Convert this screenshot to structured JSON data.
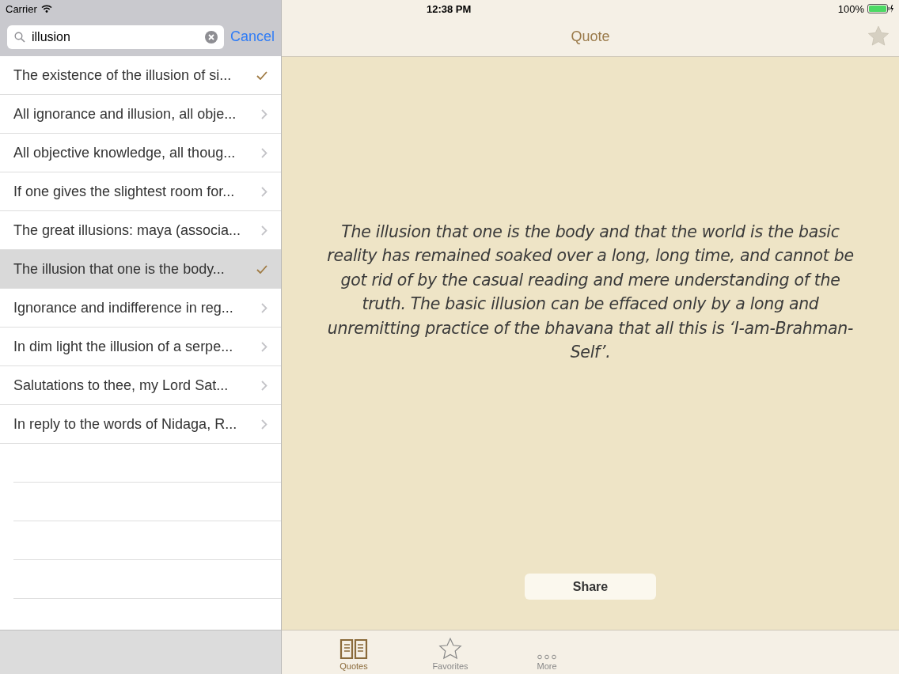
{
  "status_bar": {
    "carrier": "Carrier",
    "time": "12:38 PM",
    "battery": "100%"
  },
  "search": {
    "value": "illusion",
    "cancel": "Cancel"
  },
  "results": [
    {
      "text": "The existence of the illusion of si...",
      "kind": "check",
      "selected": false
    },
    {
      "text": "All ignorance and illusion, all obje...",
      "kind": "chevron",
      "selected": false
    },
    {
      "text": "All objective knowledge, all thoug...",
      "kind": "chevron",
      "selected": false
    },
    {
      "text": "If one gives the slightest room for...",
      "kind": "chevron",
      "selected": false
    },
    {
      "text": "The great illusions: maya (associa...",
      "kind": "chevron",
      "selected": false
    },
    {
      "text": "The illusion that one is the body...",
      "kind": "check",
      "selected": true
    },
    {
      "text": "Ignorance and indifference in reg...",
      "kind": "chevron",
      "selected": false
    },
    {
      "text": "In dim light the illusion of a serpe...",
      "kind": "chevron",
      "selected": false
    },
    {
      "text": "Salutations to thee, my Lord Sat...",
      "kind": "chevron",
      "selected": false
    },
    {
      "text": "In reply to the words of Nidaga, R...",
      "kind": "chevron",
      "selected": false
    }
  ],
  "nav": {
    "title": "Quote",
    "favorite": false
  },
  "quote": "The illusion that one is the body and that the world is the basic reality has remained soaked over a long, long time, and cannot be got rid of by the casual reading and mere understanding of the truth. The basic illusion can be effaced only by a long and unremitting practice of the bhavana that all this is ‘I-am-Brahman-Self’.",
  "share": "Share",
  "tabs": [
    {
      "label": "Quotes",
      "kind": "book",
      "selected": true
    },
    {
      "label": "Favorites",
      "kind": "star",
      "selected": false
    },
    {
      "label": "More",
      "kind": "more",
      "selected": false
    }
  ]
}
